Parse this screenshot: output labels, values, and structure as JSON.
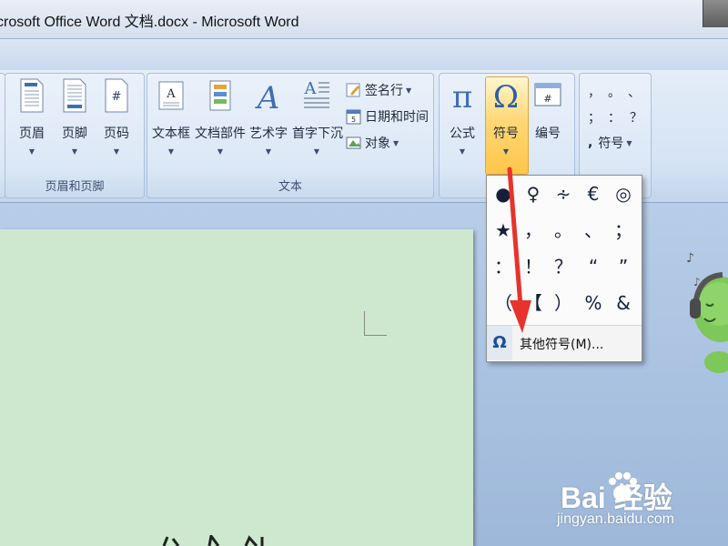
{
  "window": {
    "title": "crosoft Office Word 文档.docx - Microsoft Word"
  },
  "ribbon": {
    "groups": {
      "header_footer": "页眉和页脚",
      "text": "文本",
      "symbols": ""
    },
    "buttons": {
      "header": "页眉",
      "footer": "页脚",
      "page_number": "页码",
      "textbox": "文本框",
      "quick_parts": "文档部件",
      "wordart": "艺术字",
      "drop_cap": "首字下沉",
      "signature_line": "签名行",
      "date_time": "日期和时间",
      "object": "对象",
      "equation": "公式",
      "symbol": "符号",
      "numbering": "编号",
      "special_symbol": "符号"
    },
    "punct_grid": [
      "，",
      "。",
      "、",
      "；",
      "：",
      "？"
    ]
  },
  "symbol_dropdown": {
    "symbols": [
      "●",
      "♀",
      "∻",
      "€",
      "◎",
      "★",
      "，",
      "。",
      "、",
      "；",
      "：",
      "！",
      "？",
      "“",
      "”",
      "（",
      "【",
      "）",
      "%",
      "&"
    ],
    "more_label": "其他符号(M)..."
  },
  "watermark": {
    "logo_text": "Bai  经验",
    "url": "jingyan.baidu.com"
  },
  "colors": {
    "ribbon_bg": "#dce8f6",
    "highlight": "#ffc64a",
    "page": "#cde8cf",
    "arrow": "#e8322c"
  }
}
